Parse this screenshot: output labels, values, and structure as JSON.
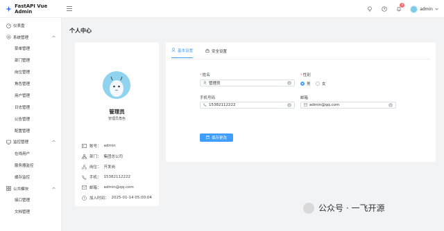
{
  "app": {
    "title": "FastAPI Vue Admin"
  },
  "header": {
    "notif_count": "3",
    "user_name": "admin"
  },
  "sidebar": {
    "dashboard": "仪表盘",
    "groups": [
      {
        "label": "系统管理",
        "items": [
          "菜单管理",
          "部门管理",
          "岗位管理",
          "角色管理",
          "用户管理",
          "日志管理",
          "公告管理",
          "配置管理"
        ]
      },
      {
        "label": "监控管理",
        "items": [
          "在线用户",
          "服务器监控",
          "缓存监控"
        ]
      },
      {
        "label": "公共模块",
        "items": [
          "接口管理",
          "文档管理"
        ]
      }
    ]
  },
  "page": {
    "title": "个人中心"
  },
  "profile": {
    "name": "管理员",
    "role": "管理员角色",
    "info": [
      {
        "icon": "id-card-icon",
        "label": "账号：",
        "value": "admin"
      },
      {
        "icon": "department-icon",
        "label": "部门：",
        "value": "集团总公司"
      },
      {
        "icon": "position-icon",
        "label": "岗位：",
        "value": "开发岗"
      },
      {
        "icon": "phone-icon",
        "label": "手机：",
        "value": "15382112222"
      },
      {
        "icon": "mail-icon",
        "label": "邮箱：",
        "value": "admin@qq.com"
      },
      {
        "icon": "clock-icon",
        "label": "加入时间：",
        "value": "2025-01-14 05:00:04"
      }
    ]
  },
  "tabs": {
    "basic": "基本设置",
    "security": "安全设置"
  },
  "form": {
    "name_label": "姓名",
    "name_value": "管理员",
    "gender_label": "性别",
    "gender_male": "男",
    "gender_female": "女",
    "phone_label": "手机号码",
    "phone_value": "15382112222",
    "email_label": "邮箱",
    "email_value": "admin@qq.com",
    "save_label": "保存更改"
  },
  "watermark": {
    "text": "公众号 · 一飞开源"
  },
  "colors": {
    "primary": "#409eff",
    "badge": "#f56c6c"
  }
}
